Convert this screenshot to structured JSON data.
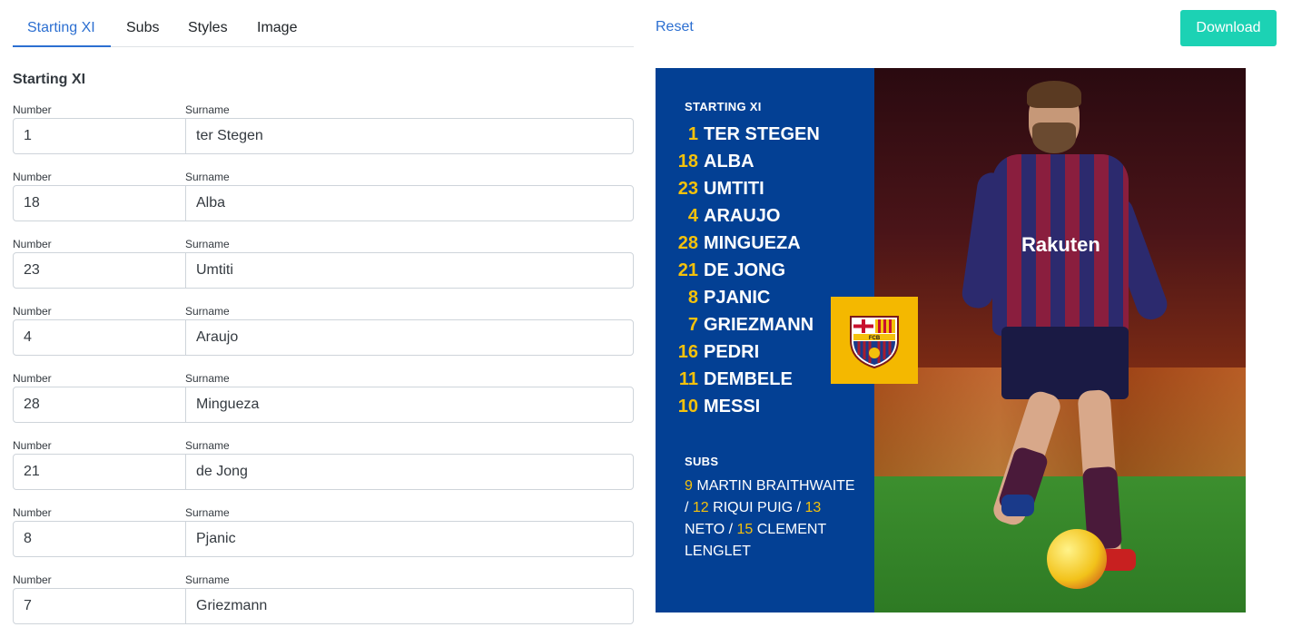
{
  "tabs": [
    {
      "label": "Starting XI",
      "active": true
    },
    {
      "label": "Subs",
      "active": false
    },
    {
      "label": "Styles",
      "active": false
    },
    {
      "label": "Image",
      "active": false
    }
  ],
  "header": {
    "reset_label": "Reset",
    "download_label": "Download"
  },
  "form": {
    "section_title": "Starting XI",
    "number_label": "Number",
    "surname_label": "Surname",
    "players": [
      {
        "number": "1",
        "surname": "ter Stegen"
      },
      {
        "number": "18",
        "surname": "Alba"
      },
      {
        "number": "23",
        "surname": "Umtiti"
      },
      {
        "number": "4",
        "surname": "Araujo"
      },
      {
        "number": "28",
        "surname": "Mingueza"
      },
      {
        "number": "21",
        "surname": "de Jong"
      },
      {
        "number": "8",
        "surname": "Pjanic"
      },
      {
        "number": "7",
        "surname": "Griezmann"
      }
    ]
  },
  "preview": {
    "starting_heading": "STARTING XI",
    "starting": [
      {
        "number": "1",
        "name": "TER STEGEN"
      },
      {
        "number": "18",
        "name": "ALBA"
      },
      {
        "number": "23",
        "name": "UMTITI"
      },
      {
        "number": "4",
        "name": "ARAUJO"
      },
      {
        "number": "28",
        "name": "MINGUEZA"
      },
      {
        "number": "21",
        "name": "DE JONG"
      },
      {
        "number": "8",
        "name": "PJANIC"
      },
      {
        "number": "7",
        "name": "GRIEZMANN"
      },
      {
        "number": "16",
        "name": "PEDRI"
      },
      {
        "number": "11",
        "name": "DEMBELE"
      },
      {
        "number": "10",
        "name": "MESSI"
      }
    ],
    "subs_heading": "SUBS",
    "subs": [
      {
        "number": "9",
        "name": "MARTIN BRAITHWAITE"
      },
      {
        "number": "12",
        "name": "RIQUI PUIG"
      },
      {
        "number": "13",
        "name": "NETO"
      },
      {
        "number": "15",
        "name": "CLEMENT LENGLET"
      }
    ],
    "subs_separator": " / ",
    "crest_letters": "FCB",
    "photo_sponsor": "Rakuten"
  },
  "colors": {
    "accent": "#2c6fd1",
    "download_button": "#1cd2b4",
    "panel_blue": "#034094",
    "number_yellow": "#f4c10c",
    "crest_background": "#f4b800"
  }
}
